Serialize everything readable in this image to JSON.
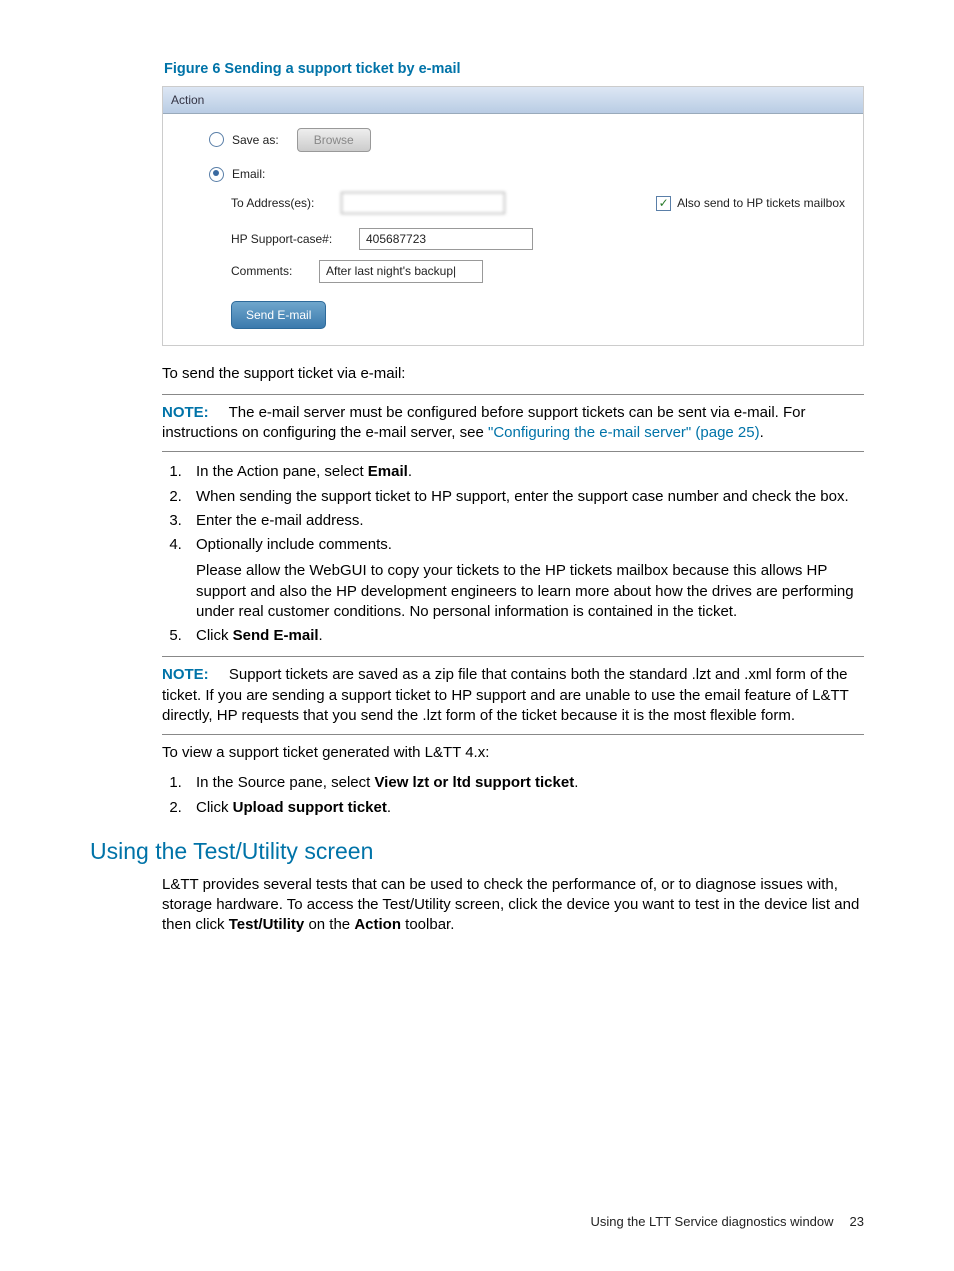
{
  "figure_caption": "Figure 6 Sending a support ticket by e-mail",
  "screenshot": {
    "panel_title": "Action",
    "save_as_label": "Save as:",
    "browse_label": "Browse",
    "email_label": "Email:",
    "to_address_label": "To Address(es):",
    "to_address_value": "",
    "also_send_label": "Also send to HP tickets mailbox",
    "support_case_label": "HP Support-case#:",
    "support_case_value": "405687723",
    "comments_label": "Comments:",
    "comments_value": "After last night's backup|",
    "send_button": "Send E-mail"
  },
  "intro_text": "To send the support ticket via e-mail:",
  "note1": {
    "label": "NOTE:",
    "text_a": "The e-mail server must be configured before support tickets can be sent via e-mail. For instructions on configuring the e-mail server, see ",
    "link": "\"Configuring the e-mail server\" (page 25)",
    "text_b": "."
  },
  "steps1": {
    "s1_a": "In the Action pane, select ",
    "s1_b": "Email",
    "s1_c": ".",
    "s2": "When sending the support ticket to HP support, enter the support case number and check the box.",
    "s3": "Enter the e-mail address.",
    "s4": "Optionally include comments.",
    "s4_sub": "Please allow the WebGUI to copy your tickets to the HP tickets mailbox because this allows HP support and also the HP development engineers to learn more about how the drives are performing under real customer conditions. No personal information is contained in the ticket.",
    "s5_a": "Click ",
    "s5_b": "Send E-mail",
    "s5_c": "."
  },
  "note2": {
    "label": "NOTE:",
    "text": "Support tickets are saved as a zip file that contains both the standard .lzt and .xml form of the ticket. If you are sending a support ticket to HP support and are unable to use the email feature of L&TT directly, HP requests that you send the .lzt form of the ticket because it is the most flexible form."
  },
  "view_text": "To view a support ticket generated with L&TT 4.x:",
  "steps2": {
    "s1_a": "In the Source pane, select ",
    "s1_b": "View lzt or ltd support ticket",
    "s1_c": ".",
    "s2_a": "Click ",
    "s2_b": "Upload support ticket",
    "s2_c": "."
  },
  "section_heading": "Using the Test/Utility screen",
  "section_body_a": "L&TT provides several tests that can be used to check the performance of, or to diagnose issues with, storage hardware. To access the Test/Utility screen, click the device you want to test in the device list and then click ",
  "section_body_b": "Test/Utility",
  "section_body_c": " on the ",
  "section_body_d": "Action",
  "section_body_e": " toolbar.",
  "footer_text": "Using the LTT Service diagnostics window",
  "page_number": "23"
}
